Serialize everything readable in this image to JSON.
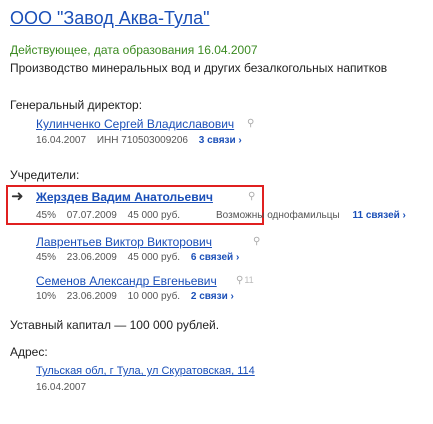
{
  "company": {
    "title": "ООО \"Завод Аква-Тула\"",
    "status": "Действующее, дата образования 16.04.2007",
    "activity": "Производство минеральных вод и других безалкогольных напитков"
  },
  "director": {
    "label": "Генеральный директор:",
    "name": "Кулинченко Сергей Владиславович",
    "date": "16.04.2007",
    "inn": "ИНН 710503009206",
    "links": "3 связи ›"
  },
  "founders": {
    "label": "Учредители:",
    "items": [
      {
        "name": "Жерздев Вадим Анатольевич",
        "percent": "45%",
        "date": "07.07.2009",
        "amount": "45 000 руб.",
        "note": "Возможны однофамильцы",
        "links": "11 связей ›"
      },
      {
        "name": "Лаврентьев Виктор Викторович",
        "percent": "45%",
        "date": "23.06.2009",
        "amount": "45 000 руб.",
        "links": "6 связей ›"
      },
      {
        "name": "Семенов Александр Евгеньевич",
        "count": "11",
        "percent": "10%",
        "date": "23.06.2009",
        "amount": "10 000 руб.",
        "links": "2 связи ›"
      }
    ]
  },
  "capital": "Уставный капитал — 100 000 рублей.",
  "address": {
    "label": "Адрес:",
    "value": "Тульская обл, г Тула, ул Скуратовская, 114",
    "date": "16.04.2007"
  }
}
